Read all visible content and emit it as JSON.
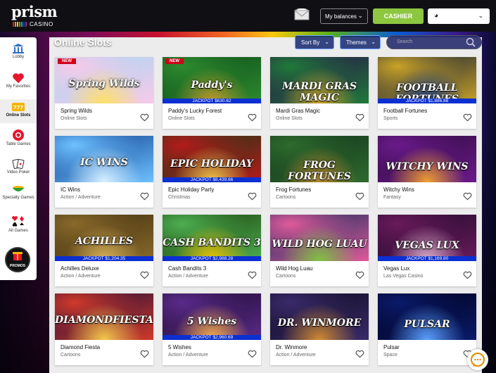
{
  "header": {
    "logo_word": "prism",
    "logo_sub": "CASINO",
    "balances_label": "My balances",
    "cashier_label": "CASHIER"
  },
  "sidebar": {
    "items": [
      {
        "label": "Lobby",
        "icon": "bank-icon"
      },
      {
        "label": "My Favorites",
        "icon": "heart-icon"
      },
      {
        "label": "Online Slots",
        "icon": "slot-777-icon",
        "active": true
      },
      {
        "label": "Table Games",
        "icon": "poker-chip-icon"
      },
      {
        "label": "Video Poker",
        "icon": "cards-icon"
      },
      {
        "label": "Specialty Games",
        "icon": "bingo-bowl-icon"
      },
      {
        "label": "All Games",
        "icon": "card-suits-icon"
      }
    ],
    "promos_label": "PROMOS"
  },
  "main": {
    "title": "Online Slots",
    "sort_label": "Sort By",
    "themes_label": "Themes",
    "search_placeholder": "Search"
  },
  "games": [
    {
      "name": "Spring Wilds",
      "category": "Online Slots",
      "badge": "NEW",
      "jackpot": "",
      "art_title": "Spring Wilds"
    },
    {
      "name": "Paddy's Lucky Forest",
      "category": "Online Slots",
      "badge": "NEW",
      "jackpot": "JACKPOT $630.62",
      "art_title": "Paddy's"
    },
    {
      "name": "Mardi Gras Magic",
      "category": "Online Slots",
      "badge": "",
      "jackpot": "",
      "art_title": "MARDI GRAS MAGIC"
    },
    {
      "name": "Football Fortunes",
      "category": "Sports",
      "badge": "",
      "jackpot": "JACKPOT $1,886.88",
      "art_title": "FOOTBALL FORTUNES"
    },
    {
      "name": "IC Wins",
      "category": "Action / Adventure",
      "badge": "",
      "jackpot": "",
      "art_title": "IC WINS"
    },
    {
      "name": "Epic Holiday Party",
      "category": "Christmas",
      "badge": "",
      "jackpot": "JACKPOT $8,439.66",
      "art_title": "EPIC HOLIDAY"
    },
    {
      "name": "Frog Fortunes",
      "category": "Cartoons",
      "badge": "",
      "jackpot": "",
      "art_title": "FROG FORTUNES"
    },
    {
      "name": "Witchy Wins",
      "category": "Fantasy",
      "badge": "",
      "jackpot": "",
      "art_title": "WITCHY WINS"
    },
    {
      "name": "Achilles Deluxe",
      "category": "Action / Adventure",
      "badge": "",
      "jackpot": "JACKPOT $1,204.35",
      "art_title": "ACHILLES"
    },
    {
      "name": "Cash Bandits 3",
      "category": "Action / Adventure",
      "badge": "",
      "jackpot": "JACKPOT $2,988.28",
      "art_title": "CASH BANDITS 3"
    },
    {
      "name": "Wild Hog Luau",
      "category": "Cartoons",
      "badge": "",
      "jackpot": "",
      "art_title": "WILD HOG LUAU"
    },
    {
      "name": "Vegas Lux",
      "category": "Las Vegas Casino",
      "badge": "",
      "jackpot": "JACKPOT $1,169.80",
      "art_title": "VEGAS LUX"
    },
    {
      "name": "Diamond Fiesta",
      "category": "Cartoons",
      "badge": "",
      "jackpot": "",
      "art_title": "DIAMONDFIESTA"
    },
    {
      "name": "5 Wishes",
      "category": "Action / Adventure",
      "badge": "",
      "jackpot": "JACKPOT $2,960.69",
      "art_title": "5 Wishes"
    },
    {
      "name": "Dr. Winmore",
      "category": "Action / Adventure",
      "badge": "",
      "jackpot": "",
      "art_title": "DR. WINMORE"
    },
    {
      "name": "Pulsar",
      "category": "Space",
      "badge": "",
      "jackpot": "",
      "art_title": "PULSAR"
    }
  ],
  "colors": {
    "cashier_green": "#8dc63f",
    "jackpot_blue": "#0b2fd1",
    "new_red": "#d0021b"
  }
}
